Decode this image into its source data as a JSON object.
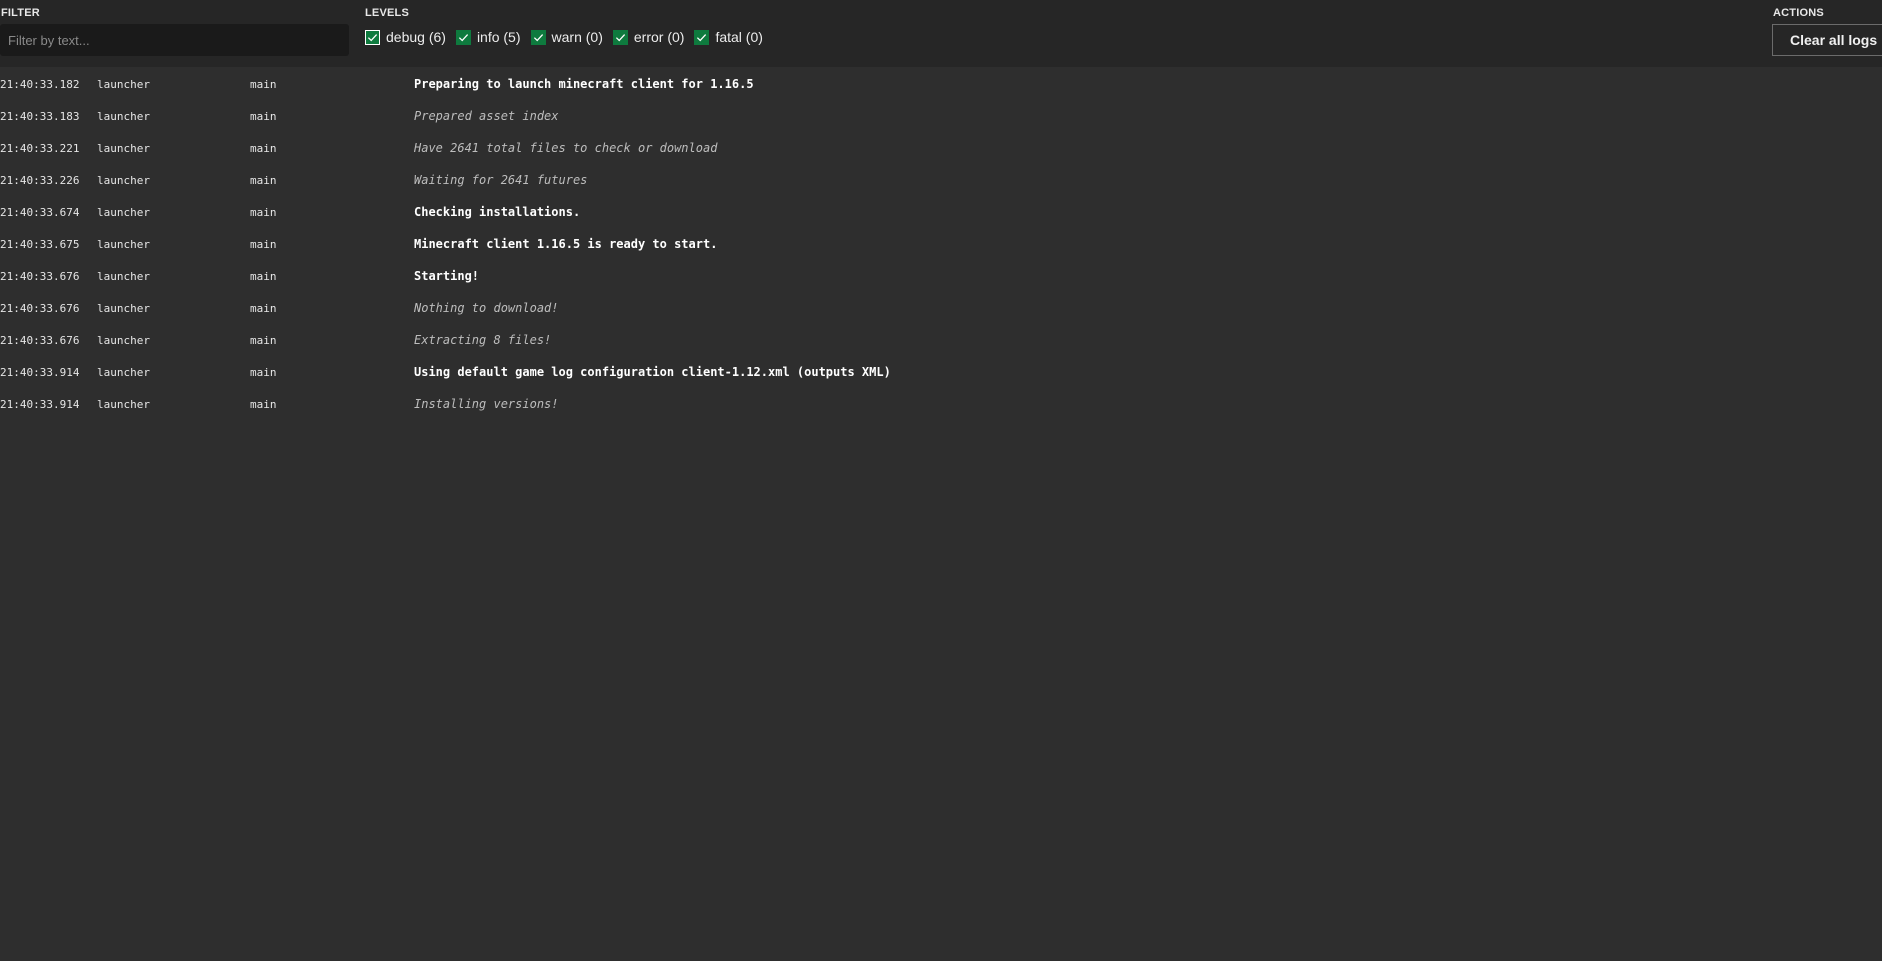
{
  "header": {
    "filter": {
      "label": "FILTER",
      "placeholder": "Filter by text...",
      "value": ""
    },
    "levels": {
      "label": "LEVELS",
      "items": [
        {
          "label": "debug (6)",
          "checked": true
        },
        {
          "label": "info (5)",
          "checked": true
        },
        {
          "label": "warn (0)",
          "checked": true
        },
        {
          "label": "error (0)",
          "checked": true
        },
        {
          "label": "fatal (0)",
          "checked": true
        }
      ]
    },
    "actions": {
      "label": "ACTIONS",
      "clear_label": "Clear all logs"
    }
  },
  "colors": {
    "header_bg": "#262626",
    "body_bg": "#2e2e2e",
    "input_bg": "#1a1a1a",
    "checkbox_green": "#0e7a3e"
  },
  "logs": [
    {
      "time": "21:40:33.182",
      "source": "launcher",
      "thread": "main",
      "level": "info",
      "message": "Preparing to launch minecraft client for 1.16.5"
    },
    {
      "time": "21:40:33.183",
      "source": "launcher",
      "thread": "main",
      "level": "debug",
      "message": "Prepared asset index"
    },
    {
      "time": "21:40:33.221",
      "source": "launcher",
      "thread": "main",
      "level": "debug",
      "message": "Have 2641 total files to check or download"
    },
    {
      "time": "21:40:33.226",
      "source": "launcher",
      "thread": "main",
      "level": "debug",
      "message": "Waiting for 2641 futures"
    },
    {
      "time": "21:40:33.674",
      "source": "launcher",
      "thread": "main",
      "level": "info",
      "message": "Checking installations."
    },
    {
      "time": "21:40:33.675",
      "source": "launcher",
      "thread": "main",
      "level": "info",
      "message": "Minecraft client 1.16.5 is ready to start."
    },
    {
      "time": "21:40:33.676",
      "source": "launcher",
      "thread": "main",
      "level": "info",
      "message": "Starting!"
    },
    {
      "time": "21:40:33.676",
      "source": "launcher",
      "thread": "main",
      "level": "debug",
      "message": "Nothing to download!"
    },
    {
      "time": "21:40:33.676",
      "source": "launcher",
      "thread": "main",
      "level": "debug",
      "message": "Extracting 8 files!"
    },
    {
      "time": "21:40:33.914",
      "source": "launcher",
      "thread": "main",
      "level": "info",
      "message": "Using default game log configuration client-1.12.xml (outputs XML)"
    },
    {
      "time": "21:40:33.914",
      "source": "launcher",
      "thread": "main",
      "level": "debug",
      "message": "Installing versions!"
    }
  ]
}
